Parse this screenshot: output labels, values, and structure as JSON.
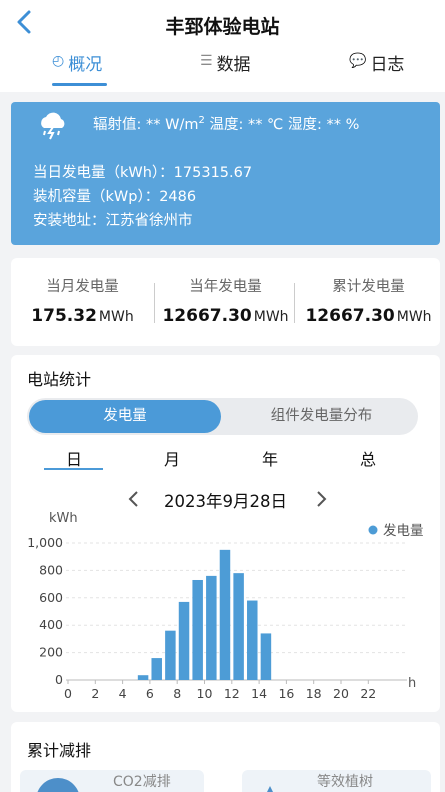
{
  "header": {
    "title": "丰郅体验电站",
    "tabs": [
      {
        "label": "概况",
        "icon": "clock-icon",
        "active": true
      },
      {
        "label": "数据",
        "icon": "list-icon",
        "active": false
      },
      {
        "label": "日志",
        "icon": "chat-icon",
        "active": false
      }
    ]
  },
  "weather": {
    "icon": "storm-cloud-icon",
    "irradiance_label": "辐射值:",
    "irradiance_value": "**",
    "irradiance_unit": "W/m",
    "irradiance_sup": "2",
    "temp_label": "温度:",
    "temp_value": "** ℃",
    "humidity_label": "湿度:",
    "humidity_value": "** %"
  },
  "station": {
    "daily_gen": "当日发电量（kWh）：175315.67",
    "capacity": "装机容量（kWp）：2486",
    "address": "安装地址：江苏省徐州市"
  },
  "stats": [
    {
      "label": "当月发电量",
      "value": "175.32",
      "unit": "MWh"
    },
    {
      "label": "当年发电量",
      "value": "12667.30",
      "unit": "MWh"
    },
    {
      "label": "累计发电量",
      "value": "12667.30",
      "unit": "MWh"
    }
  ],
  "station_stats": {
    "title": "电站统计",
    "segments": [
      "发电量",
      "组件发电量分布"
    ],
    "periods": [
      "日",
      "月",
      "年",
      "总"
    ],
    "active_period": "日",
    "date": "2023年9月28日"
  },
  "chart_data": {
    "type": "bar",
    "ylabel": "kWh",
    "xlabel": "h",
    "legend": "发电量",
    "legend_position": "top-right",
    "color": "#4d9cd6",
    "ylim": [
      0,
      1000
    ],
    "yticks": [
      "0",
      "200",
      "400",
      "600",
      "800",
      "1,000"
    ],
    "xticks": [
      "0",
      "2",
      "4",
      "6",
      "8",
      "10",
      "12",
      "14",
      "16",
      "18",
      "20",
      "22"
    ],
    "x": [
      5,
      6,
      7,
      8,
      9,
      10,
      11,
      12,
      13,
      14
    ],
    "values": [
      35,
      160,
      360,
      570,
      730,
      760,
      950,
      780,
      580,
      340
    ]
  },
  "reduction": {
    "title": "累计减排",
    "items": [
      "CO2减排",
      "等效植树"
    ]
  }
}
